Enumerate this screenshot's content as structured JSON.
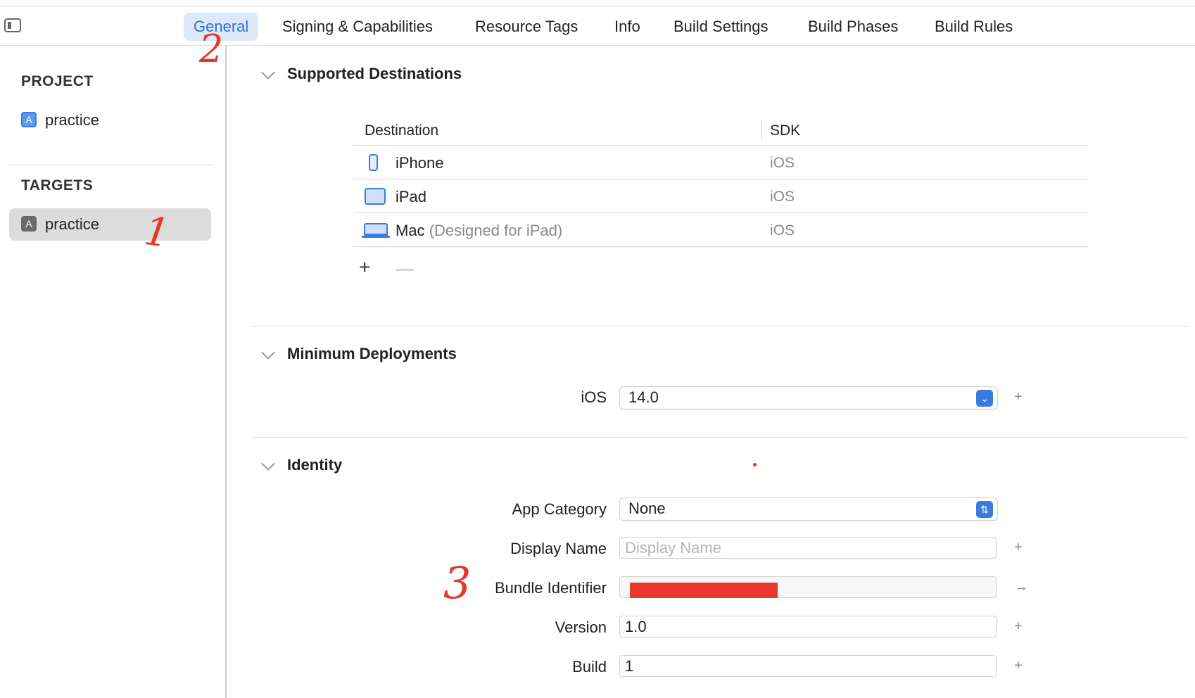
{
  "tabs": [
    {
      "label": "General",
      "active": true
    },
    {
      "label": "Signing & Capabilities"
    },
    {
      "label": "Resource Tags"
    },
    {
      "label": "Info"
    },
    {
      "label": "Build Settings"
    },
    {
      "label": "Build Phases"
    },
    {
      "label": "Build Rules"
    }
  ],
  "sidebar": {
    "project_header": "PROJECT",
    "project_item": "practice",
    "targets_header": "TARGETS",
    "target_item": "practice"
  },
  "supported_destinations": {
    "title": "Supported Destinations",
    "columns": {
      "destination": "Destination",
      "sdk": "SDK"
    },
    "rows": [
      {
        "name": "iPhone",
        "note": "",
        "sdk": "iOS",
        "icon": "iphone-icon"
      },
      {
        "name": "iPad",
        "note": "",
        "sdk": "iOS",
        "icon": "ipad-icon"
      },
      {
        "name": "Mac",
        "note": "(Designed for iPad)",
        "sdk": "iOS",
        "icon": "mac-icon"
      }
    ],
    "add_symbol": "+",
    "remove_symbol": "—"
  },
  "minimum_deployments": {
    "title": "Minimum Deployments",
    "ios_label": "iOS",
    "ios_value": "14.0",
    "add_symbol": "+"
  },
  "identity": {
    "title": "Identity",
    "app_category_label": "App Category",
    "app_category_value": "None",
    "display_name_label": "Display Name",
    "display_name_placeholder": "Display Name",
    "display_name_value": "",
    "bundle_identifier_label": "Bundle Identifier",
    "bundle_identifier_value": "",
    "version_label": "Version",
    "version_value": "1.0",
    "build_label": "Build",
    "build_value": "1",
    "add_symbol": "+",
    "arrow_symbol": "→"
  },
  "annotations": {
    "step1": "1",
    "step2": "2",
    "step3": "3"
  },
  "colors": {
    "accent": "#2f6fd6",
    "annotation": "#e23a2a",
    "selection": "#dcdcdc"
  }
}
